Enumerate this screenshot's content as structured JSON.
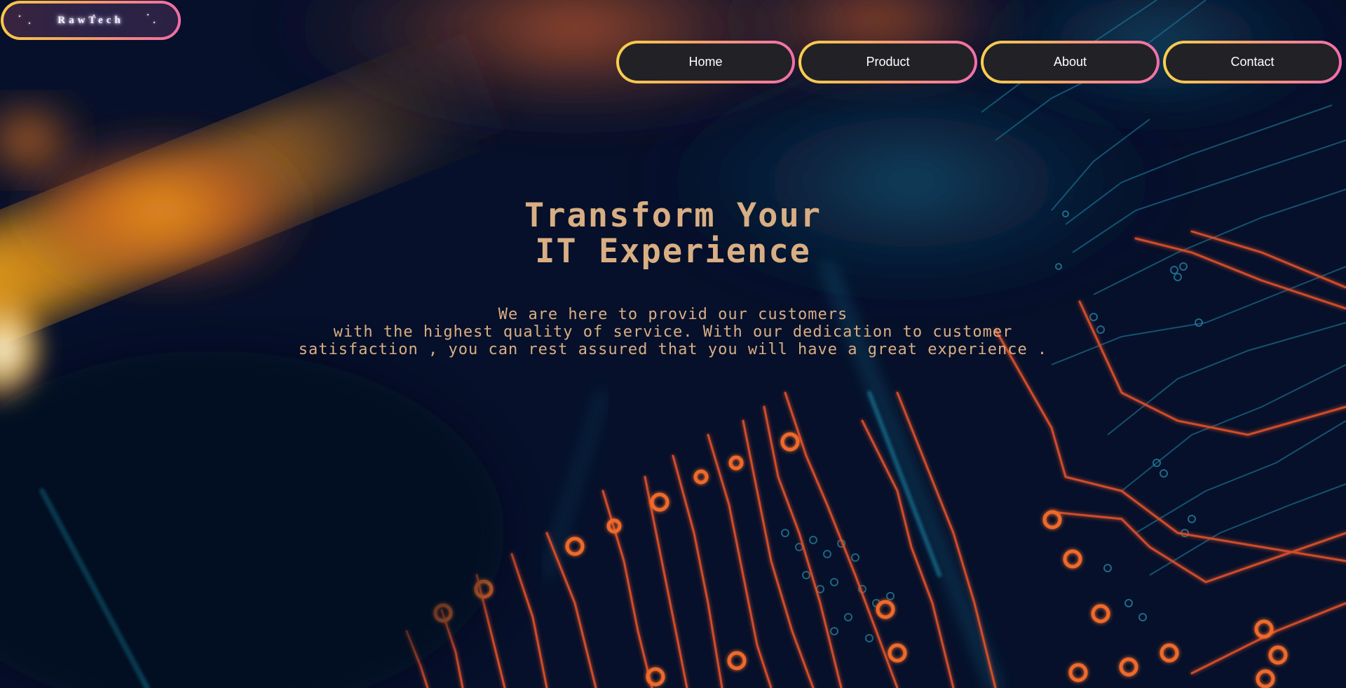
{
  "brand": {
    "logo_text": "RawTech"
  },
  "nav": {
    "items": [
      {
        "label": "Home"
      },
      {
        "label": "Product"
      },
      {
        "label": "About"
      },
      {
        "label": "Contact"
      }
    ]
  },
  "hero": {
    "title_line1": "Transform Your",
    "title_line2": "IT Experience",
    "text_line1": "We are here to provid our customers",
    "text_line2": "with the highest quality of service. With our dedication to customer",
    "text_line3": "satisfaction , you can rest assured that you will have a great experience ."
  },
  "colors": {
    "background": "#06102a",
    "accent_gradient_start": "#f7d04c",
    "accent_gradient_end": "#f26ea9",
    "nav_fill": "#222226",
    "hero_text": "#d9ae83",
    "circuit_orange": "#e8562a",
    "circuit_teal": "#1c8fb0"
  }
}
